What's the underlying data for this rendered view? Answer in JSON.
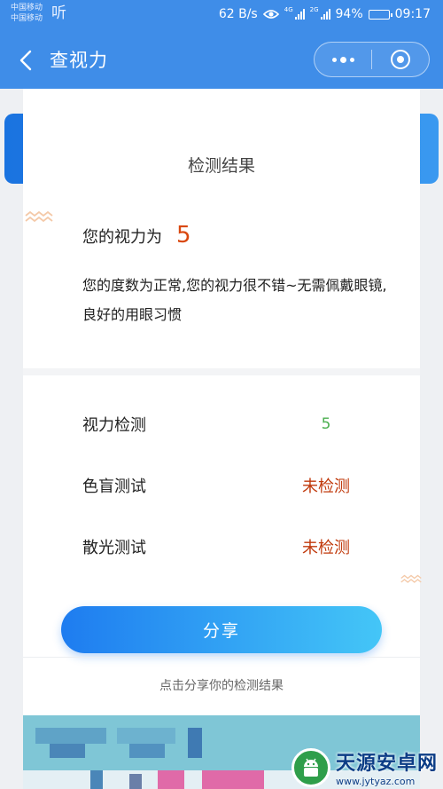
{
  "status_bar": {
    "carrier_1": "中国移动",
    "carrier_2": "中国移动",
    "ear_icon": "听",
    "speed": "62 B/s",
    "network_1": "4G",
    "network_2": "2G",
    "battery": "94%",
    "time": "09:17"
  },
  "nav": {
    "title": "查视力"
  },
  "result": {
    "title": "检测结果",
    "vision_label": "您的视力为",
    "vision_value": "5",
    "desc_line1": "您的度数为正常,您的视力很不错~无需佩戴眼镜,",
    "desc_line2": "良好的用眼习惯"
  },
  "tests": [
    {
      "label": "视力检测",
      "value": "5",
      "status_color": "#4caf50"
    },
    {
      "label": "色盲测试",
      "value": "未检测",
      "status_color": "#c0390b"
    },
    {
      "label": "散光测试",
      "value": "未检测",
      "status_color": "#c0390b"
    }
  ],
  "share_button": "分享",
  "hint": "点击分享你的检测结果",
  "watermark": {
    "name": "天源安卓网",
    "url": "www.jytyaz.com"
  },
  "colors": {
    "brand_blue": "#3f8de8",
    "vision_value": "#d9480f",
    "ok_green": "#4caf50",
    "pending_red": "#c0390b"
  },
  "icons": [
    "back-arrow-icon",
    "more-dots-icon",
    "target-close-icon",
    "eye-icon",
    "signal-icon",
    "battery-icon",
    "zigzag-icon",
    "android-logo-icon"
  ]
}
